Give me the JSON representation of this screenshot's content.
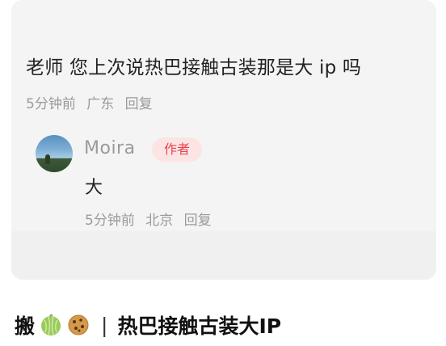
{
  "comment": {
    "text": "老师 您上次说热巴接触古装那是大 ip 吗",
    "time": "5分钟前",
    "location": "广东",
    "reply_label": "回复"
  },
  "reply": {
    "username": "Moira",
    "badge": "作者",
    "text": "大",
    "time": "5分钟前",
    "location": "北京",
    "reply_label": "回复"
  },
  "post": {
    "prefix": "搬",
    "separator": "|",
    "title": "热巴接触古装大IP",
    "emojis": [
      "melon-icon",
      "cookie-icon"
    ]
  },
  "colors": {
    "badge_bg": "#fde4e4",
    "badge_text": "#e5434b",
    "meta_text": "#9a9a9a",
    "card_bg": "#f4f4f4"
  }
}
